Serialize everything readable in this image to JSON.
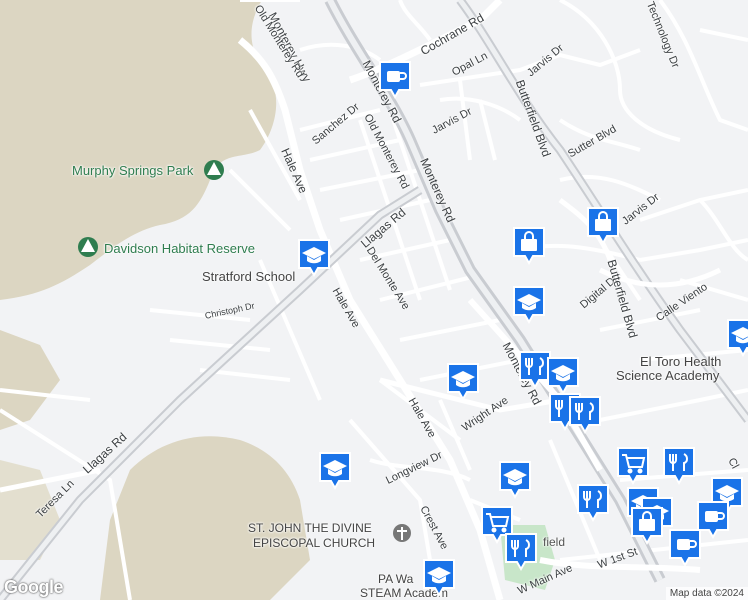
{
  "map": {
    "roads": {
      "monterey_hwy": "Monterey Hwy",
      "old_monterey_rd_top": "Old Monterey Rd",
      "monterey_rd_top": "Monterey Rd",
      "monterey_rd_mid": "Monterey Rd",
      "monterey_rd_low": "Monterey Rd",
      "cochrane_rd": "Cochrane Rd",
      "opal_ln": "Opal Ln",
      "jarvis_dr_top": "Jarvis Dr",
      "jarvis_dr_mid": "Jarvis Dr",
      "jarvis_dr_right": "Jarvis Dr",
      "butterfield_blvd_top": "Butterfield Blvd",
      "butterfield_blvd_mid": "Butterfield Blvd",
      "sutter_blvd": "Sutter Blvd",
      "technology_dr": "Technology Dr",
      "sanchez_dr": "Sanchez Dr",
      "old_monterey_rd_mid": "Old Monterey Rd",
      "hale_ave_top": "Hale Ave",
      "hale_ave_mid": "Hale Ave",
      "hale_ave_low": "Hale Ave",
      "llagas_rd_top": "Llagas Rd",
      "llagas_rd_low": "Llagas Rd",
      "del_monte_ave": "Del Monte Ave",
      "christoph_dr": "Christoph Dr",
      "digital_dr": "Digital Dr",
      "calle_viento": "Calle Viento",
      "wright_ave": "Wright Ave",
      "longview_dr": "Longview Dr",
      "crest_ave": "Crest Ave",
      "teresa_ln": "Teresa Ln",
      "w_1st_st": "W 1st St",
      "w_main_ave": "W Main Ave",
      "cl": "Cl"
    },
    "places": {
      "murphy_springs_park": "Murphy Springs Park",
      "davidson_habitat_reserve": "Davidson Habitat Reserve",
      "stratford_school": "Stratford School",
      "el_toro_line1": "El Toro Health",
      "el_toro_line2": "Science Academy",
      "st_john_line1": "ST. JOHN THE DIVINE",
      "st_john_line2": "EPISCOPAL CHURCH",
      "pa_wa_line1": "PA Wa",
      "pa_wa_line2": "STEAM Academ",
      "field_fragment": "field"
    },
    "colors": {
      "hill": "#dcd6c2",
      "park": "#c8e6c9",
      "road": "#ffffff",
      "highway": "#c9ccd1",
      "pin": "#1a73e8",
      "poi_green": "#2f7d4f"
    },
    "footer": {
      "logo": "Google",
      "attribution": "Map data ©2024"
    }
  }
}
